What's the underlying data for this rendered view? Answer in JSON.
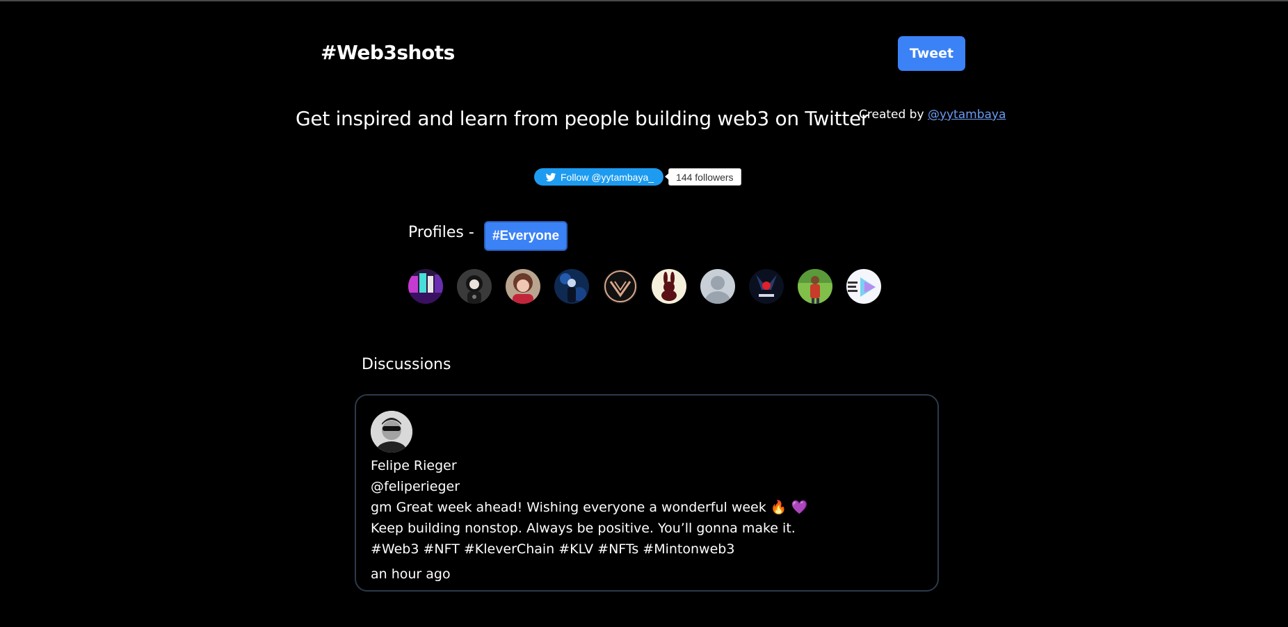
{
  "header": {
    "brand": "#Web3shots",
    "tweet_label": "Tweet"
  },
  "tagline": "Get inspired and learn from people building web3 on Twitter",
  "credit": {
    "prefix": "Created by ",
    "handle": "@yytambaya"
  },
  "follow_widget": {
    "button_label": "Follow @yytambaya_",
    "followers": "144 followers"
  },
  "profiles": {
    "label": "Profiles -",
    "filter_label": "#Everyone",
    "avatars": [
      "avatar-1",
      "avatar-2",
      "avatar-3",
      "avatar-4",
      "avatar-5",
      "avatar-6",
      "avatar-7",
      "avatar-8",
      "avatar-9",
      "avatar-10"
    ]
  },
  "discussions": {
    "heading": "Discussions",
    "posts": [
      {
        "name": "Felipe Rieger",
        "handle": "@feliperieger",
        "line1": "gm Great week ahead! Wishing everyone a wonderful week 🔥 💜",
        "line2": "Keep building nonstop. Always be positive. You’ll gonna make it.",
        "line3": "#Web3 #NFT #KleverChain #KLV #NFTs #Mintonweb3",
        "time": "an hour ago"
      }
    ]
  },
  "colors": {
    "background": "#000000",
    "accent": "#3b82f6",
    "twitter_blue": "#1d9bf0",
    "link": "#6b9cf2",
    "card_border": "#2c3a4c"
  }
}
